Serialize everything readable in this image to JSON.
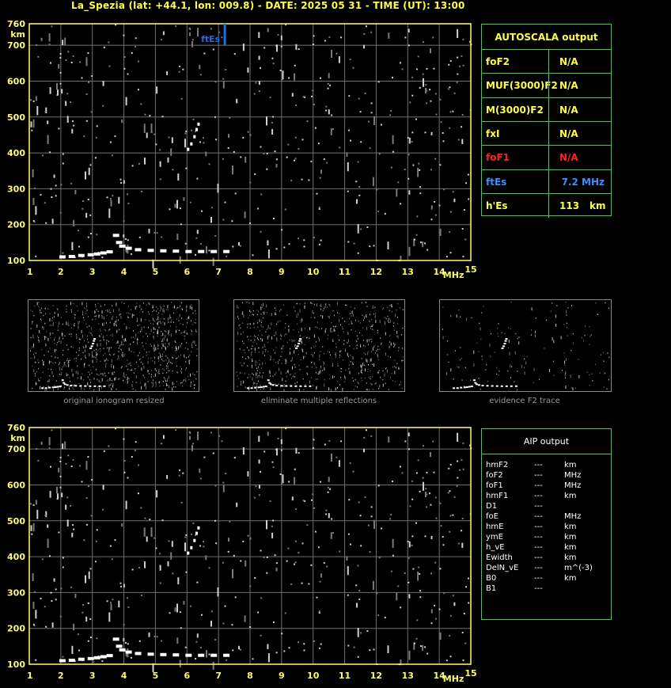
{
  "header": {
    "title": "La_Spezia (lat: +44.1, lon: 009.8) - DATE: 2025 05 31 - TIME (UT): 13:00"
  },
  "colors": {
    "axis": "#ffff66",
    "grid": "#6f6f6f",
    "trace": "#ffffff",
    "fEs_marker": "#1e6fe6",
    "table_border": "#3fd03f",
    "title_yellow": "#ffff44",
    "foF1_red": "#ff2020",
    "ftEs_blue": "#3a8fff"
  },
  "autoscala": {
    "title": "AUTOSCALA output",
    "rows": [
      {
        "label": "foF2",
        "value": "N/A",
        "unit": "",
        "color": "#ffff44"
      },
      {
        "label": "MUF(3000)F2",
        "value": "N/A",
        "unit": "",
        "color": "#ffff44"
      },
      {
        "label": "M(3000)F2",
        "value": "N/A",
        "unit": "",
        "color": "#ffff44"
      },
      {
        "label": "fxI",
        "value": "N/A",
        "unit": "",
        "color": "#ffff44"
      },
      {
        "label": "foF1",
        "value": "N/A",
        "unit": "",
        "color": "#ff2020"
      },
      {
        "label": "ftEs",
        "value": "7.2 MHz",
        "unit": "",
        "color": "#3a8fff"
      },
      {
        "label": "h'Es",
        "value": "113",
        "unit": "km",
        "color": "#ffff44"
      }
    ]
  },
  "aip": {
    "title": "AIP output",
    "rows": [
      {
        "label": "hmF2",
        "value": "---",
        "unit": "km"
      },
      {
        "label": "foF2",
        "value": "---",
        "unit": "MHz"
      },
      {
        "label": "foF1",
        "value": "---",
        "unit": "MHz"
      },
      {
        "label": "hmF1",
        "value": "---",
        "unit": "km"
      },
      {
        "label": "D1",
        "value": "---",
        "unit": ""
      },
      {
        "label": "foE",
        "value": "---",
        "unit": "MHz"
      },
      {
        "label": "hmE",
        "value": "---",
        "unit": "km"
      },
      {
        "label": "ymE",
        "value": "---",
        "unit": "km"
      },
      {
        "label": "h_vE",
        "value": "---",
        "unit": "km"
      },
      {
        "label": "Ewidth",
        "value": "---",
        "unit": "km"
      },
      {
        "label": "DelN_vE",
        "value": "---",
        "unit": "m^(-3)"
      },
      {
        "label": "B0",
        "value": "---",
        "unit": "km"
      },
      {
        "label": "B1",
        "value": "---",
        "unit": ""
      }
    ]
  },
  "captions": {
    "original": "original ionogram resized",
    "multiple": "eliminate multiple reflections",
    "evidence": "evidence F2 trace"
  },
  "chart_data": [
    {
      "type": "scatter",
      "title": "",
      "xlabel": "MHz",
      "ylabel": "km",
      "xlim": [
        1,
        15
      ],
      "ylim": [
        100,
        760
      ],
      "x_ticks": [
        1,
        2,
        3,
        4,
        5,
        6,
        7,
        8,
        9,
        10,
        11,
        12,
        13,
        14,
        15
      ],
      "y_ticks": [
        100,
        200,
        300,
        400,
        500,
        600,
        700,
        760
      ],
      "annotations": [
        {
          "text": "ftEs",
          "x": 7.2
        }
      ],
      "series": [
        {
          "values": [
            {
              "x": 2.0,
              "y": 110
            },
            {
              "x": 2.3,
              "y": 111
            },
            {
              "x": 2.6,
              "y": 114
            },
            {
              "x": 2.9,
              "y": 116
            },
            {
              "x": 3.1,
              "y": 118
            },
            {
              "x": 3.3,
              "y": 121
            },
            {
              "x": 3.5,
              "y": 124
            },
            {
              "x": 3.7,
              "y": 170
            },
            {
              "x": 3.8,
              "y": 150
            },
            {
              "x": 3.9,
              "y": 140
            },
            {
              "x": 4.1,
              "y": 134
            },
            {
              "x": 4.4,
              "y": 130
            },
            {
              "x": 4.8,
              "y": 128
            },
            {
              "x": 5.2,
              "y": 127
            },
            {
              "x": 5.6,
              "y": 126
            },
            {
              "x": 6.0,
              "y": 125
            },
            {
              "x": 6.4,
              "y": 125
            },
            {
              "x": 6.8,
              "y": 125
            },
            {
              "x": 7.2,
              "y": 125
            }
          ]
        },
        {
          "values": [
            {
              "x": 6.05,
              "y": 410
            },
            {
              "x": 6.15,
              "y": 425
            },
            {
              "x": 6.25,
              "y": 445
            },
            {
              "x": 6.32,
              "y": 465
            },
            {
              "x": 6.38,
              "y": 480
            }
          ]
        }
      ],
      "fEs_marker": {
        "x": 7.2,
        "y_from": 700,
        "y_to": 760
      }
    },
    {
      "type": "scatter",
      "title": "",
      "xlabel": "MHz",
      "ylabel": "km",
      "xlim": [
        1,
        15
      ],
      "ylim": [
        100,
        760
      ],
      "x_ticks": [
        1,
        2,
        3,
        4,
        5,
        6,
        7,
        8,
        9,
        10,
        11,
        12,
        13,
        14,
        15
      ],
      "y_ticks": [
        100,
        200,
        300,
        400,
        500,
        600,
        700,
        760
      ],
      "series": [
        {
          "values": [
            {
              "x": 2.0,
              "y": 110
            },
            {
              "x": 2.3,
              "y": 111
            },
            {
              "x": 2.6,
              "y": 114
            },
            {
              "x": 2.9,
              "y": 116
            },
            {
              "x": 3.1,
              "y": 118
            },
            {
              "x": 3.3,
              "y": 121
            },
            {
              "x": 3.5,
              "y": 124
            },
            {
              "x": 3.7,
              "y": 170
            },
            {
              "x": 3.8,
              "y": 150
            },
            {
              "x": 3.9,
              "y": 140
            },
            {
              "x": 4.1,
              "y": 134
            },
            {
              "x": 4.4,
              "y": 130
            },
            {
              "x": 4.8,
              "y": 128
            },
            {
              "x": 5.2,
              "y": 127
            },
            {
              "x": 5.6,
              "y": 126
            },
            {
              "x": 6.0,
              "y": 125
            },
            {
              "x": 6.4,
              "y": 125
            },
            {
              "x": 6.8,
              "y": 125
            },
            {
              "x": 7.2,
              "y": 125
            }
          ]
        },
        {
          "values": [
            {
              "x": 6.05,
              "y": 410
            },
            {
              "x": 6.15,
              "y": 425
            },
            {
              "x": 6.25,
              "y": 445
            },
            {
              "x": 6.32,
              "y": 465
            },
            {
              "x": 6.38,
              "y": 480
            }
          ]
        }
      ]
    }
  ]
}
